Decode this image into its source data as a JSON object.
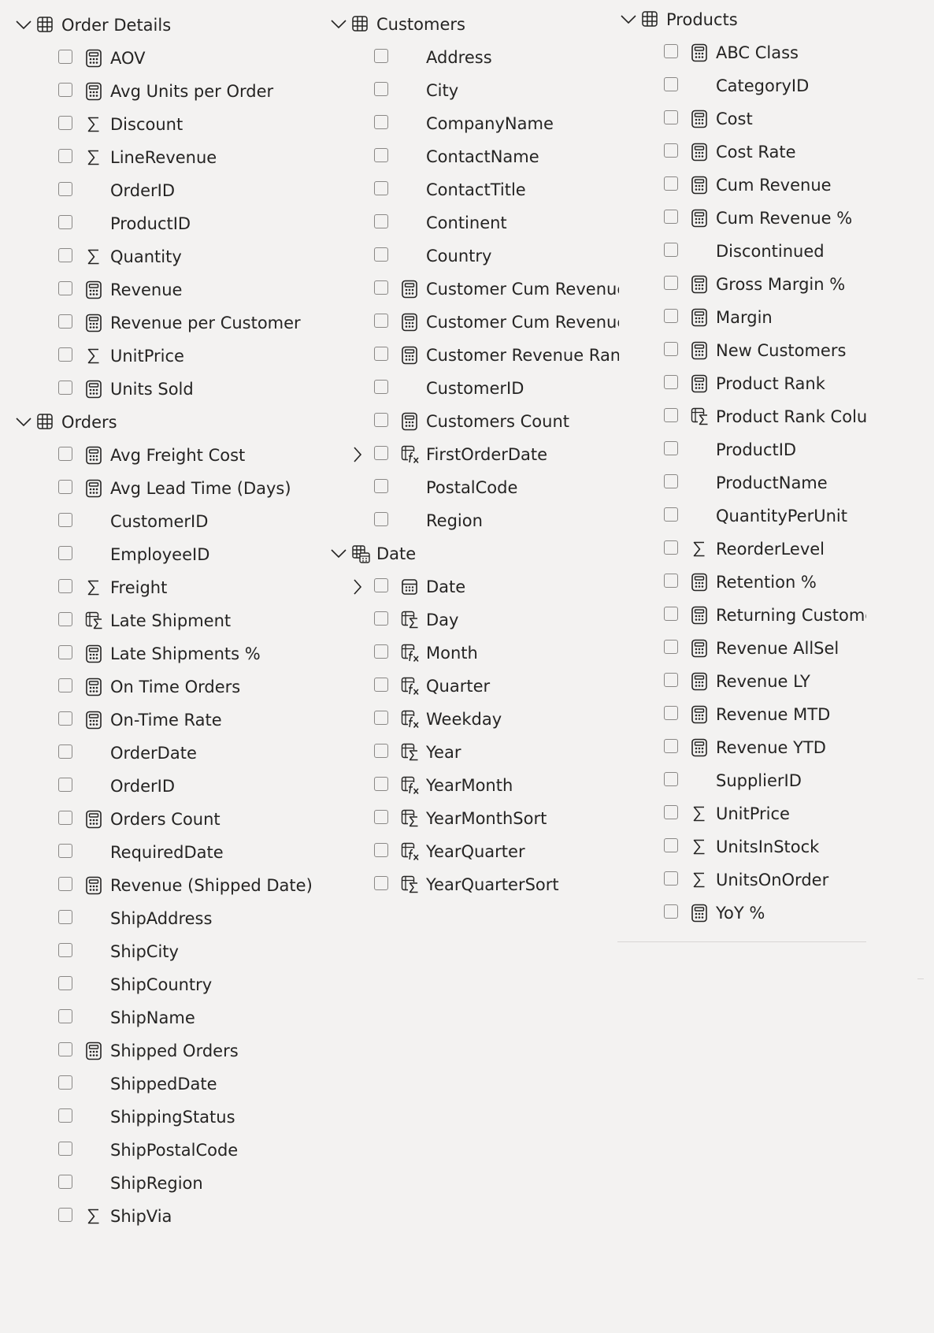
{
  "tables": [
    {
      "name": "Order Details",
      "fields": [
        {
          "label": "AOV",
          "icon": "calculator-icon"
        },
        {
          "label": "Avg Units per Order",
          "icon": "calculator-icon"
        },
        {
          "label": "Discount",
          "icon": "sigma-icon"
        },
        {
          "label": "LineRevenue",
          "icon": "sigma-icon"
        },
        {
          "label": "OrderID",
          "icon": ""
        },
        {
          "label": "ProductID",
          "icon": ""
        },
        {
          "label": "Quantity",
          "icon": "sigma-icon"
        },
        {
          "label": "Revenue",
          "icon": "calculator-icon"
        },
        {
          "label": "Revenue per Customer",
          "icon": "calculator-icon"
        },
        {
          "label": "UnitPrice",
          "icon": "sigma-icon"
        },
        {
          "label": "Units Sold",
          "icon": "calculator-icon"
        }
      ]
    },
    {
      "name": "Orders",
      "fields": [
        {
          "label": "Avg Freight Cost",
          "icon": "calculator-icon"
        },
        {
          "label": "Avg Lead Time (Days)",
          "icon": "calculator-icon"
        },
        {
          "label": "CustomerID",
          "icon": ""
        },
        {
          "label": "EmployeeID",
          "icon": ""
        },
        {
          "label": "Freight",
          "icon": "sigma-icon"
        },
        {
          "label": "Late Shipment",
          "icon": "calculated-column-sigma-icon"
        },
        {
          "label": "Late Shipments %",
          "icon": "calculator-icon"
        },
        {
          "label": "On Time Orders",
          "icon": "calculator-icon"
        },
        {
          "label": "On-Time Rate",
          "icon": "calculator-icon"
        },
        {
          "label": "OrderDate",
          "icon": ""
        },
        {
          "label": "OrderID",
          "icon": ""
        },
        {
          "label": "Orders Count",
          "icon": "calculator-icon"
        },
        {
          "label": "RequiredDate",
          "icon": ""
        },
        {
          "label": "Revenue (Shipped Date)",
          "icon": "calculator-icon"
        },
        {
          "label": "ShipAddress",
          "icon": ""
        },
        {
          "label": "ShipCity",
          "icon": ""
        },
        {
          "label": "ShipCountry",
          "icon": ""
        },
        {
          "label": "ShipName",
          "icon": ""
        },
        {
          "label": "Shipped Orders",
          "icon": "calculator-icon"
        },
        {
          "label": "ShippedDate",
          "icon": ""
        },
        {
          "label": "ShippingStatus",
          "icon": ""
        },
        {
          "label": "ShipPostalCode",
          "icon": ""
        },
        {
          "label": "ShipRegion",
          "icon": ""
        },
        {
          "label": "ShipVia",
          "icon": "sigma-icon"
        }
      ]
    },
    {
      "name": "Customers",
      "fields": [
        {
          "label": "Address",
          "icon": ""
        },
        {
          "label": "City",
          "icon": ""
        },
        {
          "label": "CompanyName",
          "icon": ""
        },
        {
          "label": "ContactName",
          "icon": ""
        },
        {
          "label": "ContactTitle",
          "icon": ""
        },
        {
          "label": "Continent",
          "icon": ""
        },
        {
          "label": "Country",
          "icon": ""
        },
        {
          "label": "Customer Cum Revenue",
          "icon": "calculator-icon"
        },
        {
          "label": "Customer Cum Revenue %",
          "icon": "calculator-icon"
        },
        {
          "label": "Customer Revenue Rank",
          "icon": "calculator-icon"
        },
        {
          "label": "CustomerID",
          "icon": ""
        },
        {
          "label": "Customers Count",
          "icon": "calculator-icon"
        },
        {
          "label": "FirstOrderDate",
          "icon": "calculated-column-fx-icon",
          "expandable": true
        },
        {
          "label": "PostalCode",
          "icon": ""
        },
        {
          "label": "Region",
          "icon": ""
        }
      ]
    },
    {
      "name": "Date",
      "fields": [
        {
          "label": "Date",
          "icon": "calendar-icon",
          "expandable": true
        },
        {
          "label": "Day",
          "icon": "calculated-column-sigma-icon"
        },
        {
          "label": "Month",
          "icon": "calculated-column-fx-icon"
        },
        {
          "label": "Quarter",
          "icon": "calculated-column-fx-icon"
        },
        {
          "label": "Weekday",
          "icon": "calculated-column-fx-icon"
        },
        {
          "label": "Year",
          "icon": "calculated-column-sigma-icon"
        },
        {
          "label": "YearMonth",
          "icon": "calculated-column-fx-icon"
        },
        {
          "label": "YearMonthSort",
          "icon": "calculated-column-sigma-icon"
        },
        {
          "label": "YearQuarter",
          "icon": "calculated-column-fx-icon"
        },
        {
          "label": "YearQuarterSort",
          "icon": "calculated-column-sigma-icon"
        }
      ]
    },
    {
      "name": "Products",
      "fields": [
        {
          "label": "ABC Class",
          "icon": "calculator-icon"
        },
        {
          "label": "CategoryID",
          "icon": ""
        },
        {
          "label": "Cost",
          "icon": "calculator-icon"
        },
        {
          "label": "Cost Rate",
          "icon": "calculator-icon"
        },
        {
          "label": "Cum Revenue",
          "icon": "calculator-icon"
        },
        {
          "label": "Cum Revenue %",
          "icon": "calculator-icon"
        },
        {
          "label": "Discontinued",
          "icon": ""
        },
        {
          "label": "Gross Margin %",
          "icon": "calculator-icon"
        },
        {
          "label": "Margin",
          "icon": "calculator-icon"
        },
        {
          "label": "New Customers",
          "icon": "calculator-icon"
        },
        {
          "label": "Product Rank",
          "icon": "calculator-icon"
        },
        {
          "label": "Product Rank Colum",
          "icon": "calculated-column-sigma-icon"
        },
        {
          "label": "ProductID",
          "icon": ""
        },
        {
          "label": "ProductName",
          "icon": ""
        },
        {
          "label": "QuantityPerUnit",
          "icon": ""
        },
        {
          "label": "ReorderLevel",
          "icon": "sigma-icon"
        },
        {
          "label": "Retention %",
          "icon": "calculator-icon"
        },
        {
          "label": "Returning Customers",
          "icon": "calculator-icon"
        },
        {
          "label": "Revenue AllSel",
          "icon": "calculator-icon"
        },
        {
          "label": "Revenue LY",
          "icon": "calculator-icon"
        },
        {
          "label": "Revenue MTD",
          "icon": "calculator-icon"
        },
        {
          "label": "Revenue YTD",
          "icon": "calculator-icon"
        },
        {
          "label": "SupplierID",
          "icon": ""
        },
        {
          "label": "UnitPrice",
          "icon": "sigma-icon"
        },
        {
          "label": "UnitsInStock",
          "icon": "sigma-icon"
        },
        {
          "label": "UnitsOnOrder",
          "icon": "sigma-icon"
        },
        {
          "label": "YoY %",
          "icon": "calculator-icon"
        }
      ]
    }
  ]
}
